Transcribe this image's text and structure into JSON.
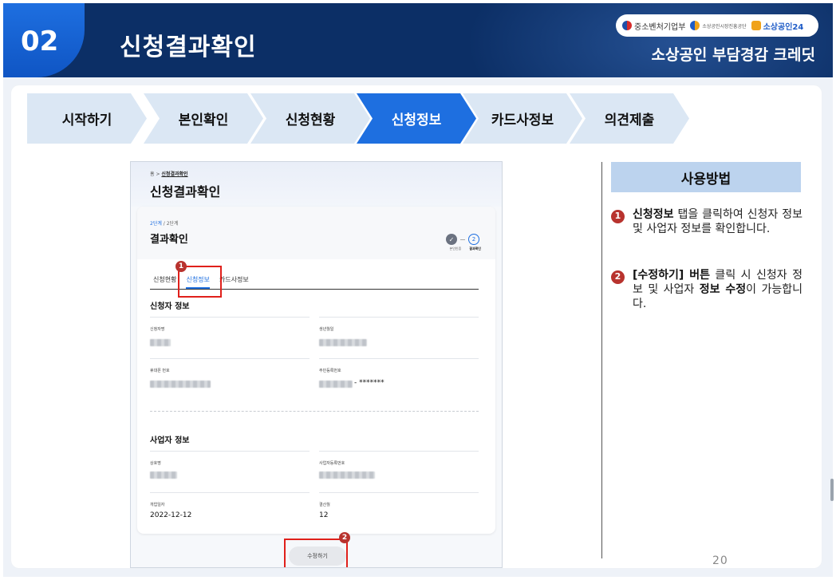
{
  "header": {
    "number": "02",
    "title": "신청결과확인",
    "subtitle": "소상공인 부담경감 크레딧",
    "logos": [
      "중소벤처기업부",
      "소상공인시장진흥공단",
      "소상공인24"
    ],
    "colors": {
      "navy": "#0c2f66",
      "blue": "#1e6fe0"
    }
  },
  "steps": [
    {
      "label": "시작하기",
      "active": false
    },
    {
      "label": "본인확인",
      "active": false
    },
    {
      "label": "신청현황",
      "active": false
    },
    {
      "label": "신청정보",
      "active": true
    },
    {
      "label": "카드사정보",
      "active": false
    },
    {
      "label": "의견제출",
      "active": false
    }
  ],
  "screenshot": {
    "breadcrumb_home": "홈",
    "breadcrumb_sep": ">",
    "breadcrumb_current": "신청결과확인",
    "page_title": "신청결과확인",
    "stage_current": "2단계",
    "stage_total": " / 2단계",
    "card_title": "결과확인",
    "progress": {
      "step1_icon": "check-icon",
      "step2_number": "2",
      "label1": "본인인증",
      "label2": "결과확인"
    },
    "tabs": [
      "신청현황",
      "신청정보",
      "카드사정보"
    ],
    "applicant_section": "신청자 정보",
    "applicant_fields": {
      "name_label": "신청자명",
      "birth_label": "생년월일",
      "phone_label": "휴대폰 번호",
      "rrn_label": "주민등록번호",
      "rrn_suffix": "- *******"
    },
    "business_section": "사업자 정보",
    "business_fields": {
      "company_label": "상호명",
      "bizno_label": "사업자등록번호",
      "open_label": "개업일자",
      "open_value": "2022-12-12",
      "settle_label": "결산월",
      "settle_value": "12"
    },
    "edit_button": "수정하기",
    "badge1": "1",
    "badge2": "2"
  },
  "howto": {
    "title": "사용방법",
    "items": [
      {
        "num": "1",
        "bold": "신청정보",
        "text": " 탭을 클릭하여 신청자 정보 및 사업자 정보를 확인합니다."
      },
      {
        "num": "2",
        "bold": "[수정하기] 버튼",
        "text": " 클릭 시 신청자 정보 및 사업자 ",
        "bold2": "정보 수정",
        "text2": "이 가능합니다."
      }
    ]
  },
  "page_number": "20"
}
